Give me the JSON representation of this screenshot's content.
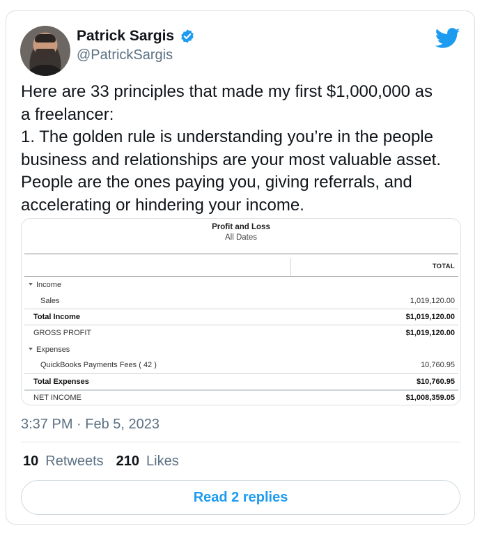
{
  "author": {
    "name": "Patrick Sargis",
    "handle": "@PatrickSargis"
  },
  "tweet": {
    "text": "Here are 33 principles that made my first $1,000,000 as\na freelancer:\n1. The golden rule is understanding you’re in the people\nbusiness and relationships are your most valuable asset.\nPeople are the ones paying you, giving referrals, and\naccelerating or hindering your income."
  },
  "report": {
    "title": "Profit and Loss",
    "subtitle": "All Dates",
    "column_header": "TOTAL",
    "rows": [
      {
        "label": "Income",
        "value": ""
      },
      {
        "label": "Sales",
        "value": "1,019,120.00"
      },
      {
        "label": "Total Income",
        "value": "$1,019,120.00"
      },
      {
        "label": "GROSS PROFIT",
        "value": "$1,019,120.00"
      },
      {
        "label": "Expenses",
        "value": ""
      },
      {
        "label": "QuickBooks Payments Fees ( 42 )",
        "value": "10,760.95"
      },
      {
        "label": "Total Expenses",
        "value": "$10,760.95"
      },
      {
        "label": "NET INCOME",
        "value": "$1,008,359.05"
      }
    ]
  },
  "meta": {
    "time": "3:37 PM",
    "separator": "·",
    "date": "Feb 5, 2023"
  },
  "stats": {
    "retweets_count": "10",
    "retweets_label": "Retweets",
    "likes_count": "210",
    "likes_label": "Likes"
  },
  "replies_button": "Read 2 replies",
  "colors": {
    "accent": "#1d9bf0",
    "secondary_text": "#5b7083"
  },
  "icons": [
    "verified-badge-icon",
    "twitter-bird-icon",
    "caret-down-icon"
  ]
}
